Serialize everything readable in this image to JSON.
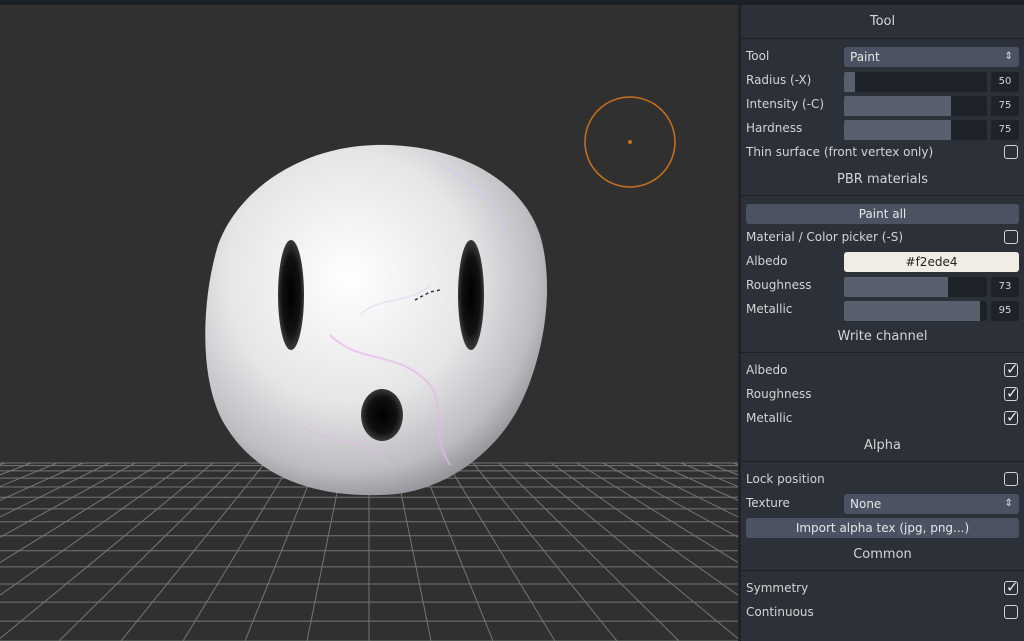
{
  "viewport": {
    "brush_color": "#c8701a",
    "grid_color": "#8c8c8c"
  },
  "panel": {
    "tool_section": {
      "title": "Tool",
      "tool_label": "Tool",
      "tool_value": "Paint",
      "radius": {
        "label": "Radius (-X)",
        "value": "50",
        "fraction": 0.08
      },
      "intensity": {
        "label": "Intensity (-C)",
        "value": "75",
        "fraction": 0.75
      },
      "hardness": {
        "label": "Hardness",
        "value": "75",
        "fraction": 0.75
      },
      "thin_surface": {
        "label": "Thin surface (front vertex only)",
        "checked": false
      }
    },
    "pbr_section": {
      "title": "PBR materials",
      "paint_all": "Paint all",
      "picker": {
        "label": "Material / Color picker (-S)",
        "checked": false
      },
      "albedo_label": "Albedo",
      "albedo_value": "#f2ede4",
      "roughness": {
        "label": "Roughness",
        "value": "73",
        "fraction": 0.73
      },
      "metallic": {
        "label": "Metallic",
        "value": "95",
        "fraction": 0.95
      }
    },
    "write_section": {
      "title": "Write channel",
      "albedo": {
        "label": "Albedo",
        "checked": true
      },
      "roughness": {
        "label": "Roughness",
        "checked": true
      },
      "metallic": {
        "label": "Metallic",
        "checked": true
      }
    },
    "alpha_section": {
      "title": "Alpha",
      "lock": {
        "label": "Lock position",
        "checked": false
      },
      "texture_label": "Texture",
      "texture_value": "None",
      "import_btn": "Import alpha tex (jpg, png...)"
    },
    "common_section": {
      "title": "Common",
      "symmetry": {
        "label": "Symmetry",
        "checked": true
      },
      "continuous": {
        "label": "Continuous",
        "checked": false
      }
    }
  }
}
